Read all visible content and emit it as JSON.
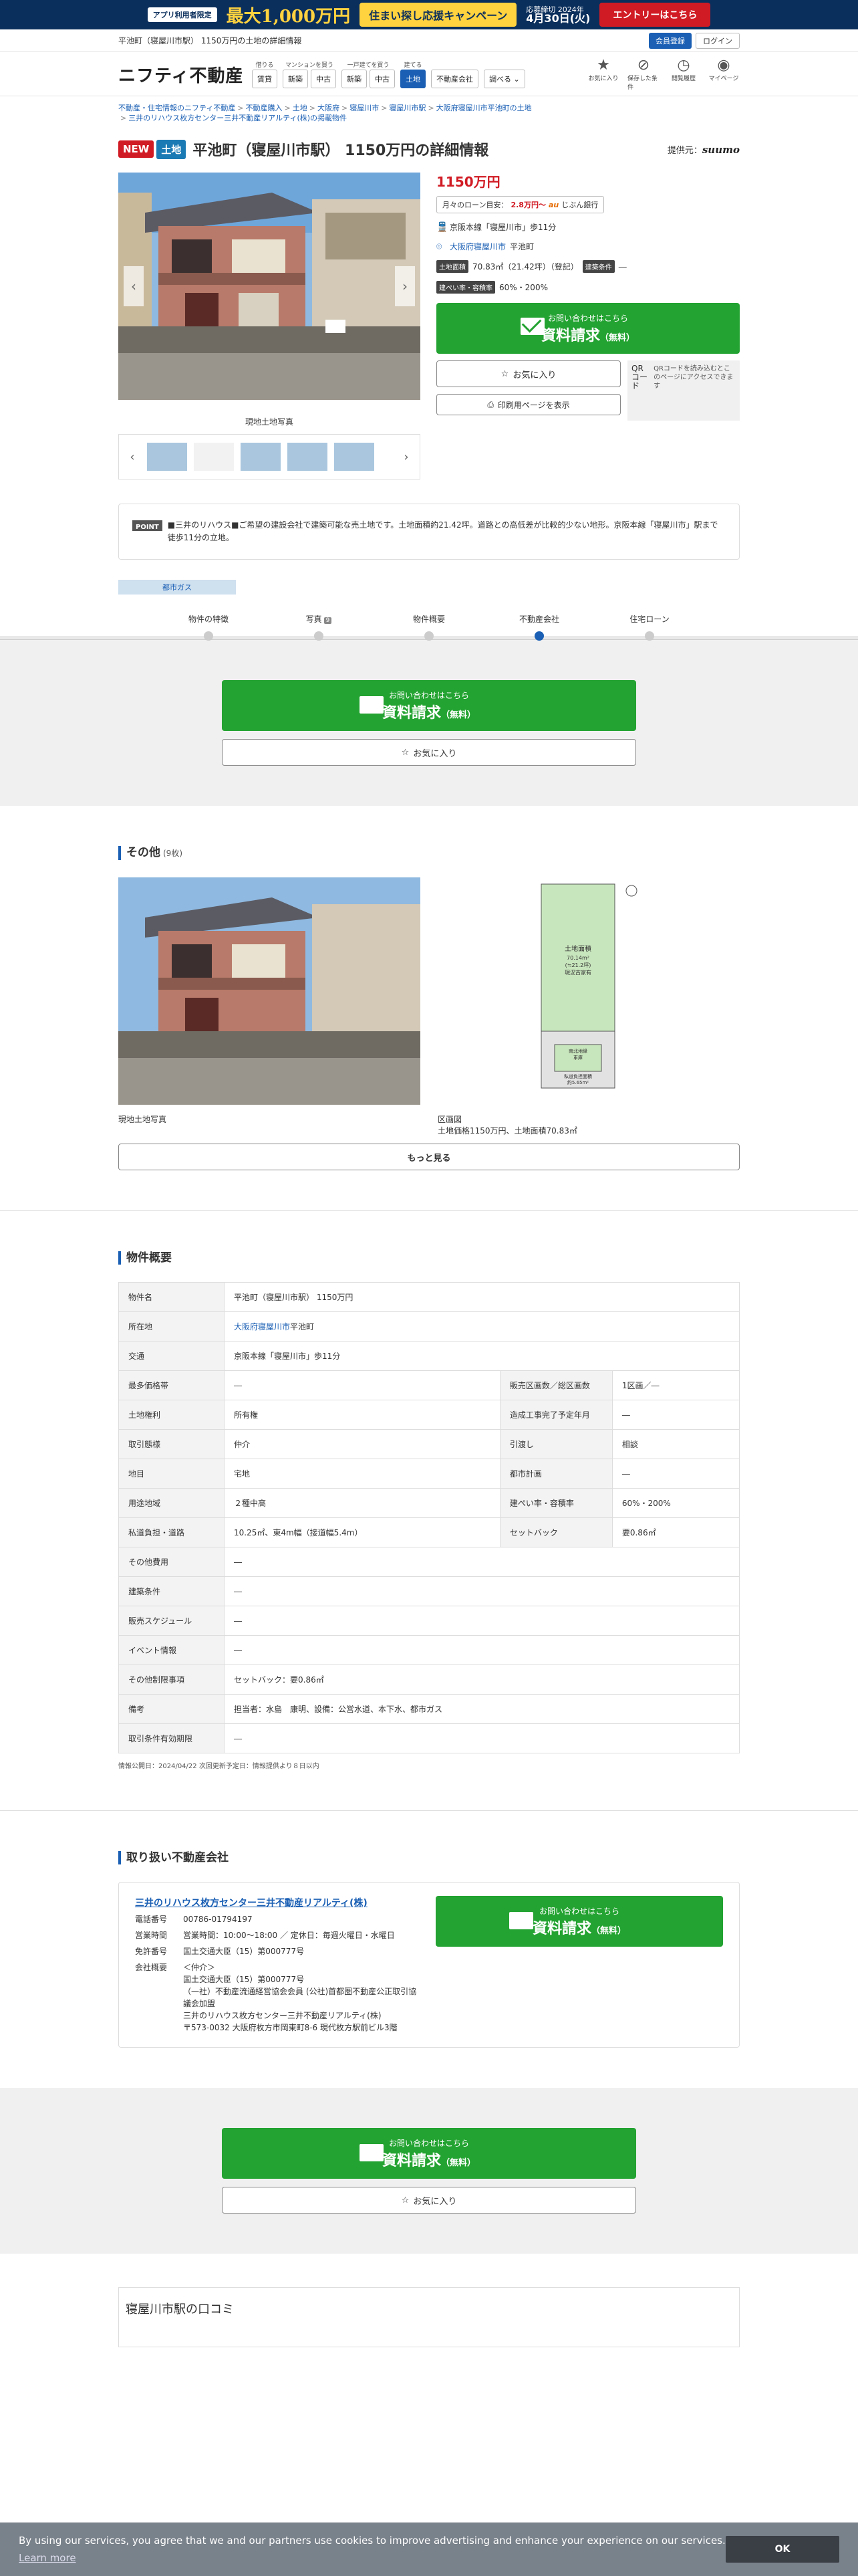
{
  "banner": {
    "chip": "アプリ利用者限定",
    "amount": "最大1,000万円",
    "campaign": "住まい探し応援キャンペーン",
    "deadline_label": "応募締切 2024年",
    "deadline": "4月30日(火)",
    "entry": "エントリーはこちら"
  },
  "topbar": {
    "title": "平池町（寝屋川市駅） 1150万円の土地の詳細情報",
    "register": "会員登録",
    "login": "ログイン"
  },
  "nav": {
    "logo": "ニフティ不動産",
    "groups": [
      {
        "cap": "借りる",
        "items": [
          "賃貸"
        ]
      },
      {
        "cap": "マンションを買う",
        "items": [
          "新築",
          "中古"
        ]
      },
      {
        "cap": "一戸建てを買う",
        "items": [
          "新築",
          "中古"
        ]
      },
      {
        "cap": "建てる",
        "items": [
          "土地"
        ]
      },
      {
        "cap": "",
        "items": [
          "不動産会社"
        ]
      },
      {
        "cap": "",
        "items": [
          "調べる ⌄"
        ]
      }
    ],
    "icons": [
      "お気に入り",
      "保存した条件",
      "閲覧履歴",
      "マイページ"
    ]
  },
  "breadcrumb": [
    "不動産・住宅情報のニフティ不動産",
    "不動産購入",
    "土地",
    "大阪府",
    "寝屋川市",
    "寝屋川市駅",
    "大阪府寝屋川市平池町の土地",
    "三井のリハウス枚方センター三井不動産リアルティ(株)の掲載物件"
  ],
  "title": {
    "new": "NEW",
    "type": "土地",
    "heading": "平池町（寝屋川市駅） 1150万円の詳細情報",
    "source_label": "提供元：",
    "source": "suumo"
  },
  "gallery": {
    "caption": "現地土地写真"
  },
  "summary": {
    "price": "1150万円",
    "loan_label": "月々のローン目安：",
    "loan_value": "2.8万円〜",
    "loan_bank": "au",
    "loan_bank_suffix": "じぶん銀行",
    "access": "京阪本線「寝屋川市」歩11分",
    "address_link": "大阪府寝屋川市",
    "address_rest": "平池町",
    "area_label": "土地面積",
    "area": "70.83㎡（21.42坪）（登記）",
    "cond_label": "建築条件",
    "cond": "―",
    "ratio_label": "建ぺい率・容積率",
    "ratio": "60%・200%"
  },
  "cta": {
    "sub": "お問い合わせはこちら",
    "main": "資料請求",
    "free": "（無料）"
  },
  "fav": "お気に入り",
  "print": "印刷用ページを表示",
  "qr": {
    "alt": "QRコード",
    "text": "QRコードを読み込むとこのページにアクセスできます"
  },
  "point": {
    "label": "POINT",
    "text": "■三井のリハウス■ご希望の建設会社で建築可能な売土地です。土地面積約21.42坪。道路との高低差が比較的少ない地形。京阪本線「寝屋川市」駅まで徒歩11分の立地。"
  },
  "gas_tag": "都市ガス",
  "tabs": [
    {
      "label": "物件の特徴"
    },
    {
      "label": "写真",
      "count": "9"
    },
    {
      "label": "物件概要"
    },
    {
      "label": "不動産会社"
    },
    {
      "label": "住宅ローン"
    }
  ],
  "others": {
    "title": "その他",
    "count": "(9枚)",
    "items": [
      {
        "caption": "現地土地写真"
      },
      {
        "caption": "区画図\n土地価格1150万円、土地面積70.83㎡"
      }
    ],
    "more": "もっと見る"
  },
  "plan": {
    "label1": "土地面積",
    "label2": "70.14m²",
    "label3": "(≒21.2坪)",
    "label4": "現況古家有",
    "label5": "南北地縁",
    "label6": "車庫",
    "label7": "私道負担面積",
    "label8": "約5.65m²"
  },
  "overview": {
    "title": "物件概要",
    "rows": [
      {
        "k": "物件名",
        "v": "平池町（寝屋川市駅） 1150万円"
      },
      {
        "k": "所在地",
        "v_link": "大阪府寝屋川市",
        "v": "平池町"
      },
      {
        "k": "交通",
        "v": "京阪本線「寝屋川市」歩11分"
      },
      {
        "k": "最多価格帯",
        "v": "―",
        "k2": "販売区画数／総区画数",
        "v2": "1区画／―"
      },
      {
        "k": "土地権利",
        "v": "所有権",
        "k2": "造成工事完了予定年月",
        "v2": "―"
      },
      {
        "k": "取引態様",
        "v": "仲介",
        "k2": "引渡し",
        "v2": "相談"
      },
      {
        "k": "地目",
        "v": "宅地",
        "k2": "都市計画",
        "v2": "―"
      },
      {
        "k": "用途地域",
        "v": "２種中高",
        "k2": "建ぺい率・容積率",
        "v2": "60%・200%"
      },
      {
        "k": "私道負担・道路",
        "v": "10.25㎡、東4m幅（接道幅5.4m）",
        "k2": "セットバック",
        "v2": "要0.86㎡"
      },
      {
        "k": "その他費用",
        "v": "―"
      },
      {
        "k": "建築条件",
        "v": "―"
      },
      {
        "k": "販売スケジュール",
        "v": "―"
      },
      {
        "k": "イベント情報",
        "v": "―"
      },
      {
        "k": "その他制限事項",
        "v": "セットバック：要0.86㎡"
      },
      {
        "k": "備考",
        "v": "担当者：水島　康明、設備：公営水道、本下水、都市ガス"
      },
      {
        "k": "取引条件有効期限",
        "v": "―"
      }
    ],
    "note": "情報公開日：2024/04/22 次回更新予定日：情報提供より８日以内"
  },
  "company": {
    "title": "取り扱い不動産会社",
    "name": "三井のリハウス枚方センター三井不動産リアルティ(株)",
    "rows": [
      {
        "k": "電話番号",
        "v": "00786-01794197"
      },
      {
        "k": "営業時間",
        "v": "営業時間：10:00〜18:00 ／ 定休日：毎週火曜日・水曜日"
      },
      {
        "k": "免許番号",
        "v": "国土交通大臣（15）第000777号"
      },
      {
        "k": "会社概要",
        "v": "＜仲介＞\n国土交通大臣（15）第000777号\n（一社）不動産流通経営協会会員 (公社)首都圏不動産公正取引協議会加盟\n三井のリハウス枚方センター三井不動産リアルティ(株)\n〒573-0032 大阪府枚方市岡東町8-6 現代枚方駅前ビル3階"
      }
    ]
  },
  "reviews": {
    "title": "寝屋川市駅の口コミ"
  },
  "cookie": {
    "text": "By using our services, you agree that we and our partners use cookies to improve advertising and enhance your experience on our services.",
    "learn": "Learn more",
    "ok": "OK"
  }
}
